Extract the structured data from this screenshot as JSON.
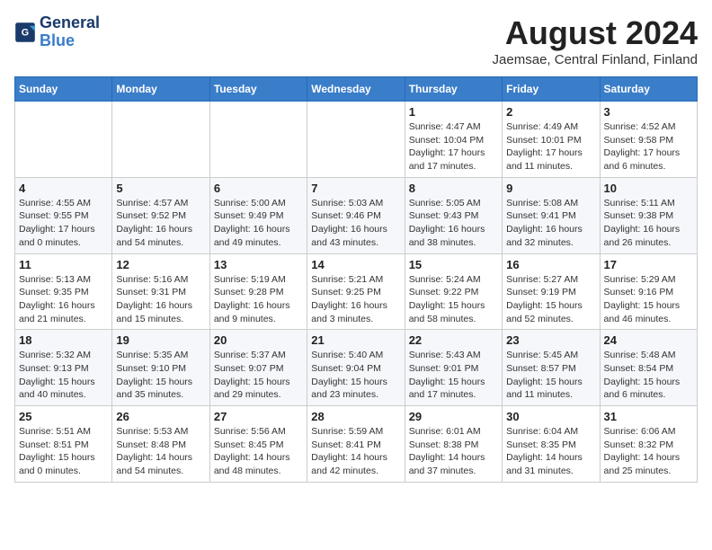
{
  "logo": {
    "line1": "General",
    "line2": "Blue"
  },
  "title": {
    "month_year": "August 2024",
    "location": "Jaemsae, Central Finland, Finland"
  },
  "weekdays": [
    "Sunday",
    "Monday",
    "Tuesday",
    "Wednesday",
    "Thursday",
    "Friday",
    "Saturday"
  ],
  "weeks": [
    [
      {
        "day": "",
        "info": ""
      },
      {
        "day": "",
        "info": ""
      },
      {
        "day": "",
        "info": ""
      },
      {
        "day": "",
        "info": ""
      },
      {
        "day": "1",
        "info": "Sunrise: 4:47 AM\nSunset: 10:04 PM\nDaylight: 17 hours\nand 17 minutes."
      },
      {
        "day": "2",
        "info": "Sunrise: 4:49 AM\nSunset: 10:01 PM\nDaylight: 17 hours\nand 11 minutes."
      },
      {
        "day": "3",
        "info": "Sunrise: 4:52 AM\nSunset: 9:58 PM\nDaylight: 17 hours\nand 6 minutes."
      }
    ],
    [
      {
        "day": "4",
        "info": "Sunrise: 4:55 AM\nSunset: 9:55 PM\nDaylight: 17 hours\nand 0 minutes."
      },
      {
        "day": "5",
        "info": "Sunrise: 4:57 AM\nSunset: 9:52 PM\nDaylight: 16 hours\nand 54 minutes."
      },
      {
        "day": "6",
        "info": "Sunrise: 5:00 AM\nSunset: 9:49 PM\nDaylight: 16 hours\nand 49 minutes."
      },
      {
        "day": "7",
        "info": "Sunrise: 5:03 AM\nSunset: 9:46 PM\nDaylight: 16 hours\nand 43 minutes."
      },
      {
        "day": "8",
        "info": "Sunrise: 5:05 AM\nSunset: 9:43 PM\nDaylight: 16 hours\nand 38 minutes."
      },
      {
        "day": "9",
        "info": "Sunrise: 5:08 AM\nSunset: 9:41 PM\nDaylight: 16 hours\nand 32 minutes."
      },
      {
        "day": "10",
        "info": "Sunrise: 5:11 AM\nSunset: 9:38 PM\nDaylight: 16 hours\nand 26 minutes."
      }
    ],
    [
      {
        "day": "11",
        "info": "Sunrise: 5:13 AM\nSunset: 9:35 PM\nDaylight: 16 hours\nand 21 minutes."
      },
      {
        "day": "12",
        "info": "Sunrise: 5:16 AM\nSunset: 9:31 PM\nDaylight: 16 hours\nand 15 minutes."
      },
      {
        "day": "13",
        "info": "Sunrise: 5:19 AM\nSunset: 9:28 PM\nDaylight: 16 hours\nand 9 minutes."
      },
      {
        "day": "14",
        "info": "Sunrise: 5:21 AM\nSunset: 9:25 PM\nDaylight: 16 hours\nand 3 minutes."
      },
      {
        "day": "15",
        "info": "Sunrise: 5:24 AM\nSunset: 9:22 PM\nDaylight: 15 hours\nand 58 minutes."
      },
      {
        "day": "16",
        "info": "Sunrise: 5:27 AM\nSunset: 9:19 PM\nDaylight: 15 hours\nand 52 minutes."
      },
      {
        "day": "17",
        "info": "Sunrise: 5:29 AM\nSunset: 9:16 PM\nDaylight: 15 hours\nand 46 minutes."
      }
    ],
    [
      {
        "day": "18",
        "info": "Sunrise: 5:32 AM\nSunset: 9:13 PM\nDaylight: 15 hours\nand 40 minutes."
      },
      {
        "day": "19",
        "info": "Sunrise: 5:35 AM\nSunset: 9:10 PM\nDaylight: 15 hours\nand 35 minutes."
      },
      {
        "day": "20",
        "info": "Sunrise: 5:37 AM\nSunset: 9:07 PM\nDaylight: 15 hours\nand 29 minutes."
      },
      {
        "day": "21",
        "info": "Sunrise: 5:40 AM\nSunset: 9:04 PM\nDaylight: 15 hours\nand 23 minutes."
      },
      {
        "day": "22",
        "info": "Sunrise: 5:43 AM\nSunset: 9:01 PM\nDaylight: 15 hours\nand 17 minutes."
      },
      {
        "day": "23",
        "info": "Sunrise: 5:45 AM\nSunset: 8:57 PM\nDaylight: 15 hours\nand 11 minutes."
      },
      {
        "day": "24",
        "info": "Sunrise: 5:48 AM\nSunset: 8:54 PM\nDaylight: 15 hours\nand 6 minutes."
      }
    ],
    [
      {
        "day": "25",
        "info": "Sunrise: 5:51 AM\nSunset: 8:51 PM\nDaylight: 15 hours\nand 0 minutes."
      },
      {
        "day": "26",
        "info": "Sunrise: 5:53 AM\nSunset: 8:48 PM\nDaylight: 14 hours\nand 54 minutes."
      },
      {
        "day": "27",
        "info": "Sunrise: 5:56 AM\nSunset: 8:45 PM\nDaylight: 14 hours\nand 48 minutes."
      },
      {
        "day": "28",
        "info": "Sunrise: 5:59 AM\nSunset: 8:41 PM\nDaylight: 14 hours\nand 42 minutes."
      },
      {
        "day": "29",
        "info": "Sunrise: 6:01 AM\nSunset: 8:38 PM\nDaylight: 14 hours\nand 37 minutes."
      },
      {
        "day": "30",
        "info": "Sunrise: 6:04 AM\nSunset: 8:35 PM\nDaylight: 14 hours\nand 31 minutes."
      },
      {
        "day": "31",
        "info": "Sunrise: 6:06 AM\nSunset: 8:32 PM\nDaylight: 14 hours\nand 25 minutes."
      }
    ]
  ]
}
